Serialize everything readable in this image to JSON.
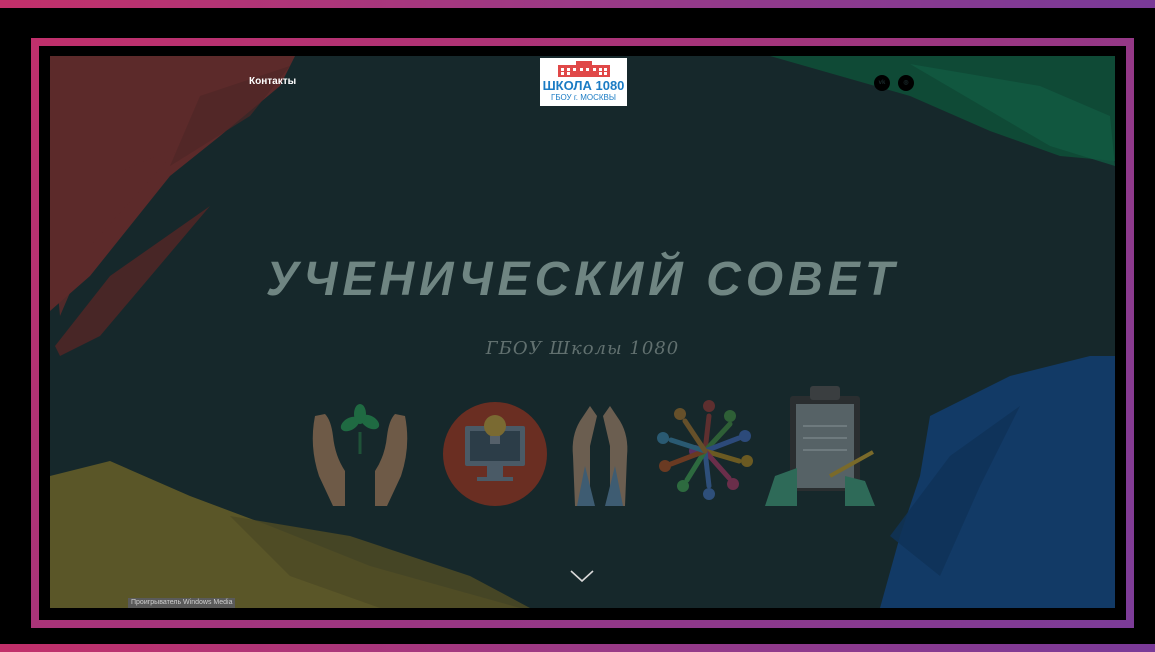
{
  "header": {
    "contacts_label": "Контакты",
    "logo": {
      "line1": "ШКОЛА 1080",
      "line2": "ГБОУ г. МОСКВЫ"
    },
    "social": [
      {
        "name": "vk-icon",
        "glyph": "vk"
      },
      {
        "name": "instagram-icon",
        "glyph": "◎"
      }
    ]
  },
  "hero": {
    "title": "УЧЕНИЧЕСКИЙ СОВЕТ",
    "subtitle": "ГБОУ Школы 1080",
    "icons": [
      "hands-sprout-icon",
      "monitor-lightbulb-icon",
      "raised-hands-icon",
      "people-circle-icon",
      "clipboard-writing-icon"
    ],
    "scroll_icon": "chevron-down-icon"
  },
  "taskbar_label": "Проигрыватель Windows Media",
  "colors": {
    "frame_left": "#c0306c",
    "frame_right": "#7c3c98",
    "hero_bg": "#16282b",
    "splash_red": "#5c2a2a",
    "splash_green": "#0f4a36",
    "splash_yellow": "#5a5628",
    "splash_blue": "#123a66"
  }
}
